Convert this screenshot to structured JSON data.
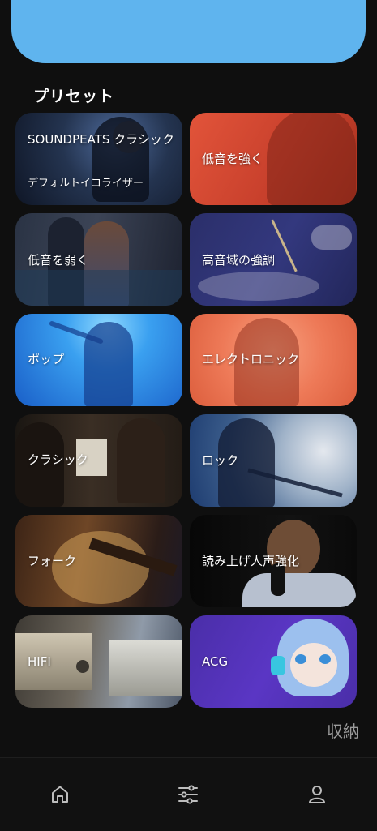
{
  "preset_section": {
    "title": "プリセット"
  },
  "presets": [
    {
      "label": "SOUNDPEATS クラシック",
      "sub": "デフォルトイコライザー"
    },
    {
      "label": "低音を強く"
    },
    {
      "label": "低音を弱く"
    },
    {
      "label": "高音域の強調"
    },
    {
      "label": "ポップ"
    },
    {
      "label": "エレクトロニック"
    },
    {
      "label": "クラシック"
    },
    {
      "label": "ロック"
    },
    {
      "label": "フォーク"
    },
    {
      "label": "読み上げ人声強化"
    },
    {
      "label": "HIFI"
    },
    {
      "label": "ACG"
    }
  ],
  "collapse_label": "収納",
  "nav": {
    "items": [
      {
        "icon": "home-icon"
      },
      {
        "icon": "equalizer-sliders-icon"
      },
      {
        "icon": "user-icon"
      }
    ]
  },
  "colors": {
    "top_bar": "#5fb4ee",
    "background": "#0f0f0f"
  }
}
